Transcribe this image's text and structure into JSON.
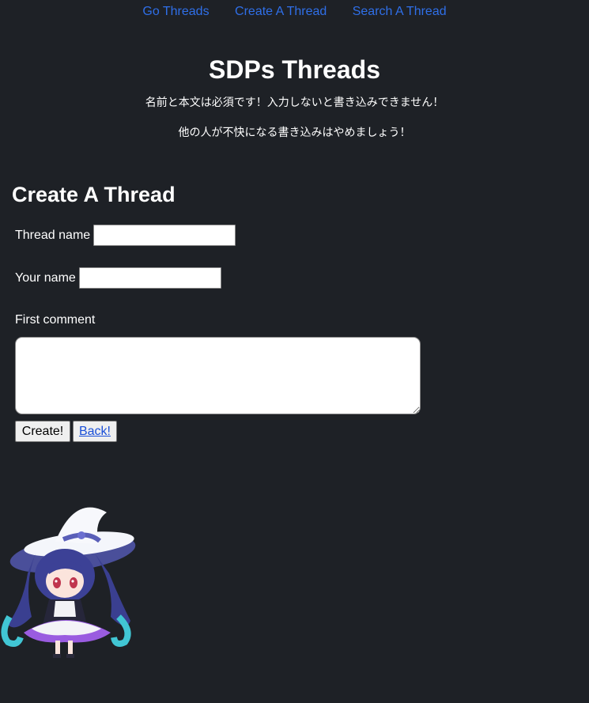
{
  "nav": {
    "items": [
      "Go Threads",
      "Create A Thread",
      "Search A Thread"
    ]
  },
  "header": {
    "title": "SDPs Threads",
    "notice1": "名前と本文は必須です！入力しないと書き込みできません！",
    "notice2": "他の人が不快になる書き込みはやめましょう！"
  },
  "form": {
    "heading": "Create A Thread",
    "thread_name_label": "Thread name",
    "thread_name_value": "",
    "your_name_label": "Your name",
    "your_name_value": "",
    "first_comment_label": "First comment",
    "first_comment_value": "",
    "create_label": "Create!",
    "back_label": "Back!"
  },
  "colors": {
    "background": "#1e2126",
    "link": "#2f6fe8",
    "text": "#ffffff"
  },
  "mascot": {
    "icon": "witch-girl-mascot-icon"
  }
}
